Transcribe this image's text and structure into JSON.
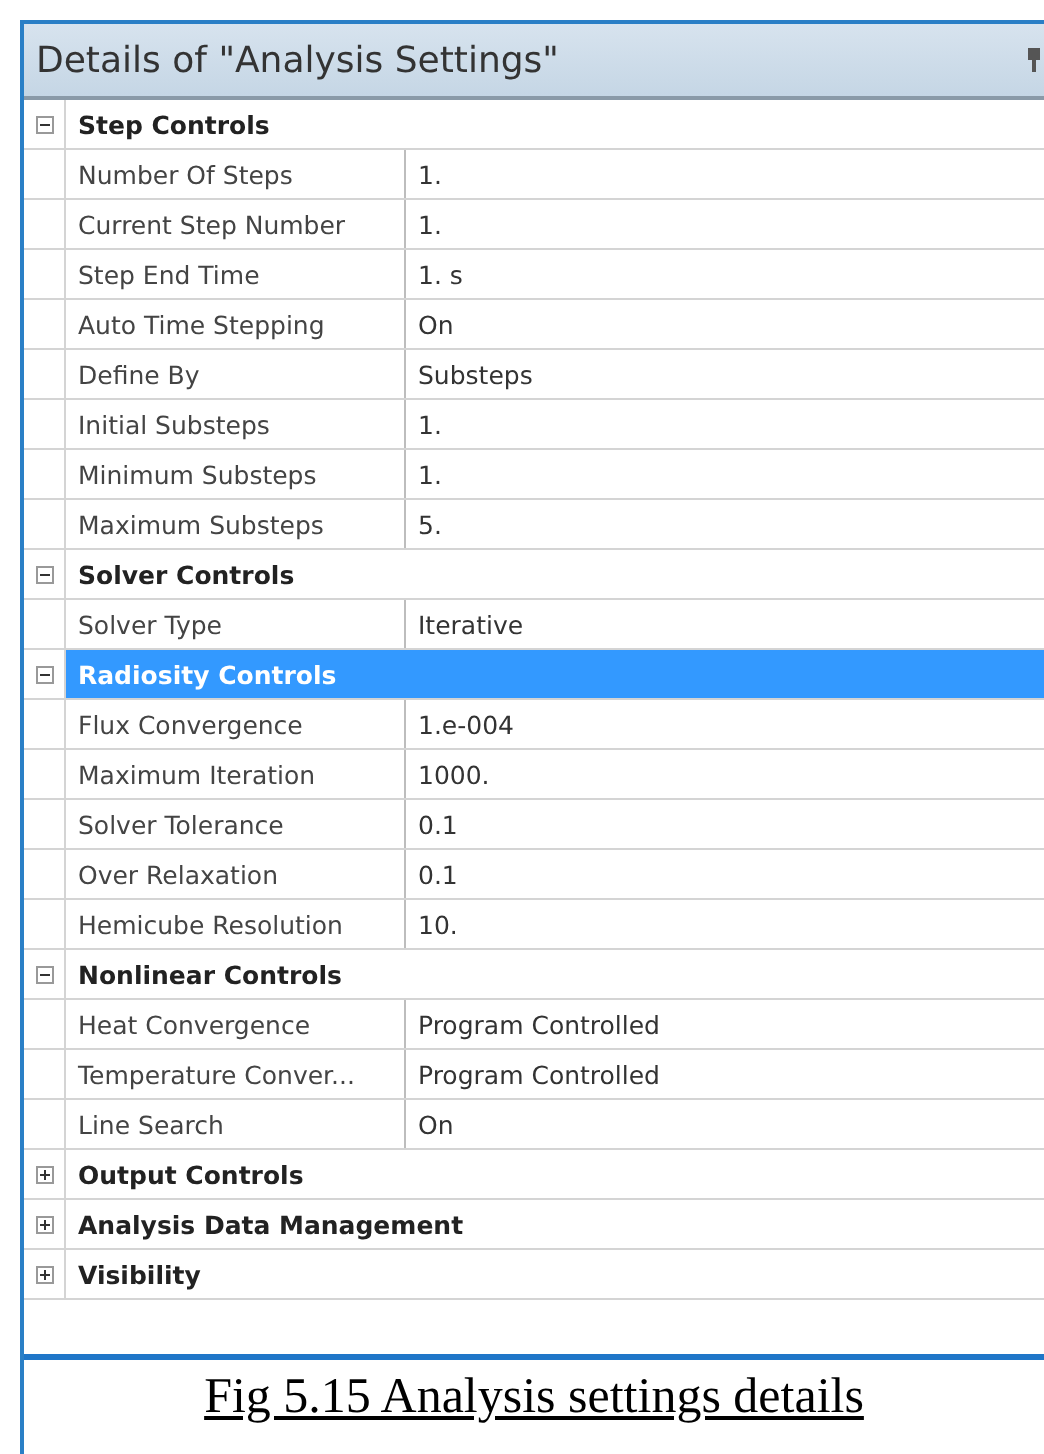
{
  "panel": {
    "title": "Details of \"Analysis Settings\""
  },
  "groups": [
    {
      "name": "Step Controls",
      "expanded": true,
      "selected": false,
      "rows": [
        {
          "label": "Number Of Steps",
          "value": "1."
        },
        {
          "label": "Current Step Number",
          "value": "1."
        },
        {
          "label": "Step End Time",
          "value": "1. s"
        },
        {
          "label": "Auto Time Stepping",
          "value": "On"
        },
        {
          "label": "Define By",
          "value": "Substeps"
        },
        {
          "label": "Initial Substeps",
          "value": "1."
        },
        {
          "label": "Minimum Substeps",
          "value": "1."
        },
        {
          "label": "Maximum Substeps",
          "value": "5."
        }
      ]
    },
    {
      "name": "Solver Controls",
      "expanded": true,
      "selected": false,
      "rows": [
        {
          "label": "Solver Type",
          "value": "Iterative"
        }
      ]
    },
    {
      "name": "Radiosity Controls",
      "expanded": true,
      "selected": true,
      "rows": [
        {
          "label": "Flux Convergence",
          "value": "1.e-004"
        },
        {
          "label": "Maximum Iteration",
          "value": "1000."
        },
        {
          "label": "Solver Tolerance",
          "value": "0.1"
        },
        {
          "label": "Over Relaxation",
          "value": "0.1"
        },
        {
          "label": "Hemicube Resolution",
          "value": "10."
        }
      ]
    },
    {
      "name": "Nonlinear Controls",
      "expanded": true,
      "selected": false,
      "rows": [
        {
          "label": "Heat Convergence",
          "value": "Program Controlled"
        },
        {
          "label": "Temperature Conver...",
          "value": "Program Controlled"
        },
        {
          "label": "Line Search",
          "value": "On"
        }
      ]
    },
    {
      "name": "Output Controls",
      "expanded": false,
      "selected": false
    },
    {
      "name": "Analysis Data Management",
      "expanded": false,
      "selected": false
    },
    {
      "name": "Visibility",
      "expanded": false,
      "selected": false
    }
  ],
  "caption": "Fig 5.15 Analysis settings details"
}
